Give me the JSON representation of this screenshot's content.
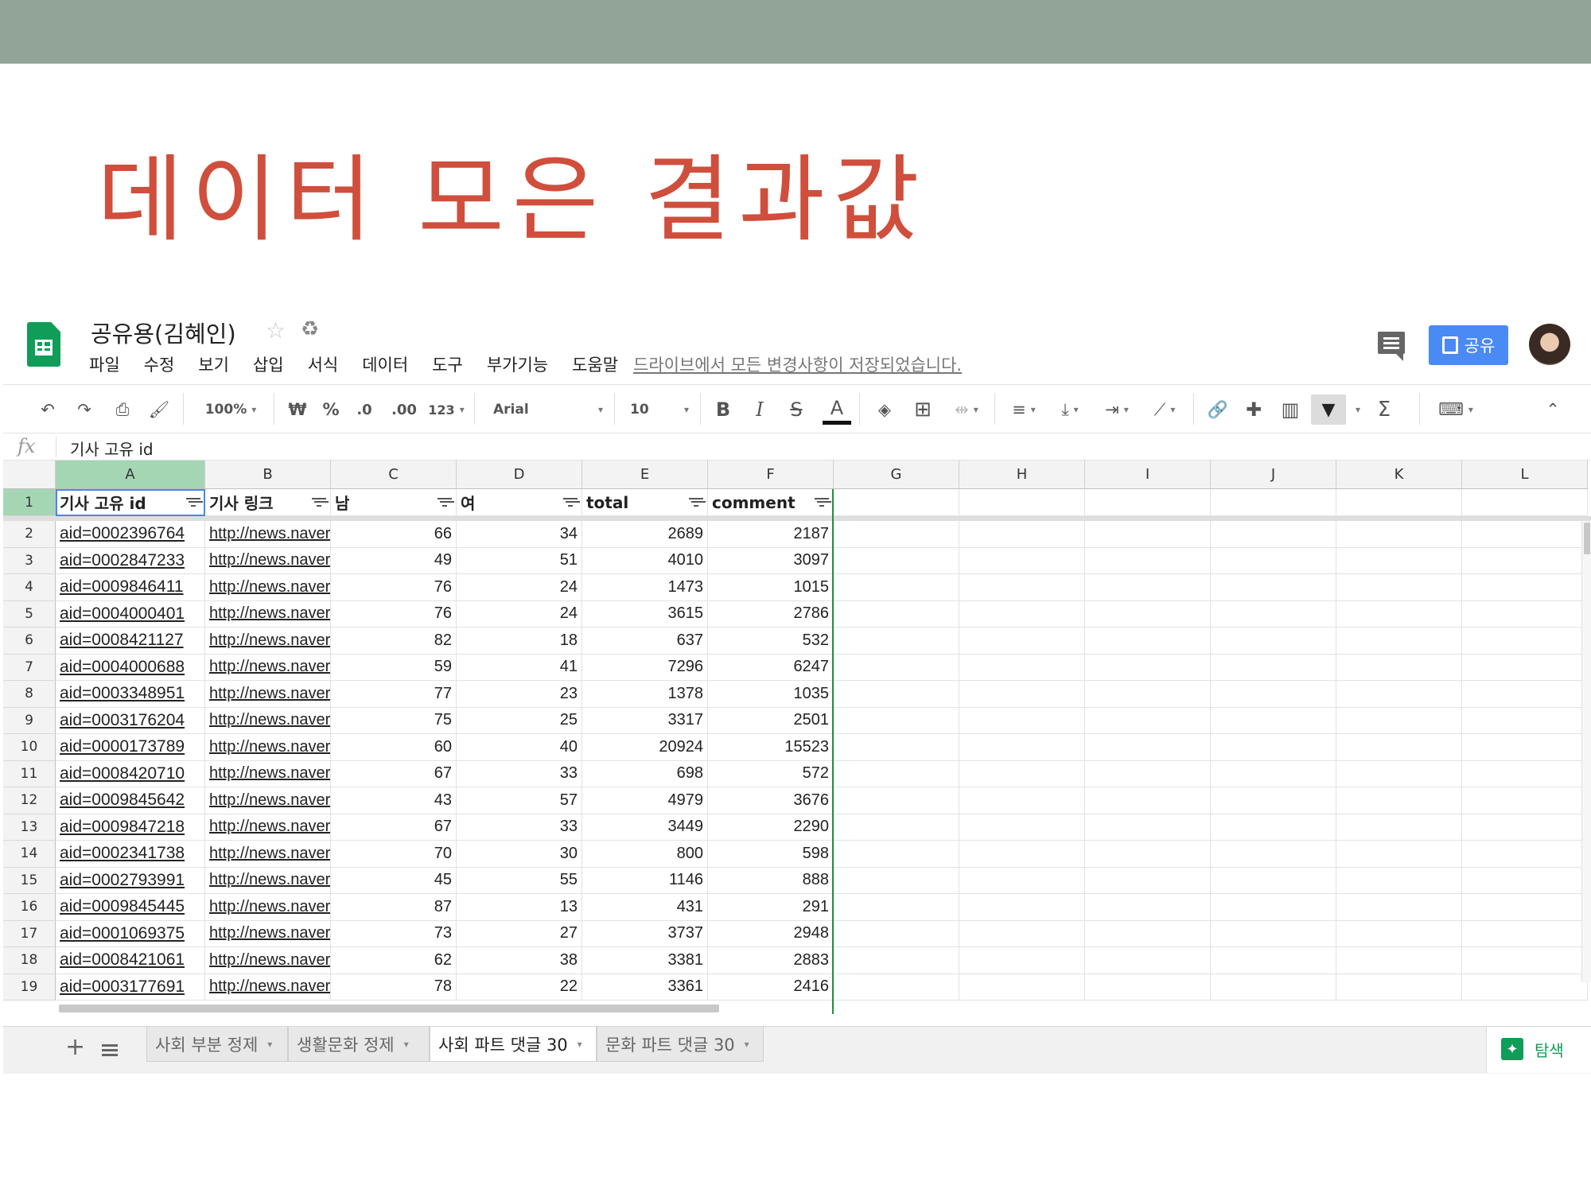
{
  "slide": {
    "title": "데이터 모은 결과값"
  },
  "doc": {
    "title": "공유용(김혜인)",
    "menu": [
      "파일",
      "수정",
      "보기",
      "삽입",
      "서식",
      "데이터",
      "도구",
      "부가기능",
      "도움말"
    ],
    "save_status": "드라이브에서 모든 변경사항이 저장되었습니다.",
    "share_label": "공유",
    "share_color": "#4a8af4"
  },
  "toolbar": {
    "zoom": "100%",
    "currency": "₩",
    "percent": "%",
    "decrease_decimals": ".0",
    "increase_decimals": ".00",
    "more_formats": "123",
    "font": "Arial",
    "font_size": "10",
    "bold": "B",
    "italic": "I",
    "strikethrough": "S",
    "text_color": "A"
  },
  "formula_bar": {
    "content": "기사 고유 id"
  },
  "grid": {
    "column_letters": [
      "A",
      "B",
      "C",
      "D",
      "E",
      "F",
      "G",
      "H",
      "I",
      "J",
      "K",
      "L"
    ],
    "headers": [
      "기사 고유 id",
      "기사 링크",
      "남",
      "여",
      "total",
      "comment"
    ],
    "rows": [
      {
        "num": "2",
        "aid": "aid=0002396764",
        "link": "http://news.naver.c",
        "m": "66",
        "f": "34",
        "total": "2689",
        "comment": "2187"
      },
      {
        "num": "3",
        "aid": "aid=0002847233",
        "link": "http://news.naver.c",
        "m": "49",
        "f": "51",
        "total": "4010",
        "comment": "3097"
      },
      {
        "num": "4",
        "aid": "aid=0009846411",
        "link": "http://news.naver.c",
        "m": "76",
        "f": "24",
        "total": "1473",
        "comment": "1015"
      },
      {
        "num": "5",
        "aid": "aid=0004000401",
        "link": "http://news.naver.c",
        "m": "76",
        "f": "24",
        "total": "3615",
        "comment": "2786"
      },
      {
        "num": "6",
        "aid": "aid=0008421127",
        "link": "http://news.naver.c",
        "m": "82",
        "f": "18",
        "total": "637",
        "comment": "532"
      },
      {
        "num": "7",
        "aid": "aid=0004000688",
        "link": "http://news.naver.c",
        "m": "59",
        "f": "41",
        "total": "7296",
        "comment": "6247"
      },
      {
        "num": "8",
        "aid": "aid=0003348951",
        "link": "http://news.naver.c",
        "m": "77",
        "f": "23",
        "total": "1378",
        "comment": "1035"
      },
      {
        "num": "9",
        "aid": "aid=0003176204",
        "link": "http://news.naver.c",
        "m": "75",
        "f": "25",
        "total": "3317",
        "comment": "2501"
      },
      {
        "num": "10",
        "aid": "aid=0000173789",
        "link": "http://news.naver.c",
        "m": "60",
        "f": "40",
        "total": "20924",
        "comment": "15523"
      },
      {
        "num": "11",
        "aid": "aid=0008420710",
        "link": "http://news.naver.c",
        "m": "67",
        "f": "33",
        "total": "698",
        "comment": "572"
      },
      {
        "num": "12",
        "aid": "aid=0009845642",
        "link": "http://news.naver.c",
        "m": "43",
        "f": "57",
        "total": "4979",
        "comment": "3676"
      },
      {
        "num": "13",
        "aid": "aid=0009847218",
        "link": "http://news.naver.c",
        "m": "67",
        "f": "33",
        "total": "3449",
        "comment": "2290"
      },
      {
        "num": "14",
        "aid": "aid=0002341738",
        "link": "http://news.naver.c",
        "m": "70",
        "f": "30",
        "total": "800",
        "comment": "598"
      },
      {
        "num": "15",
        "aid": "aid=0002793991",
        "link": "http://news.naver.c",
        "m": "45",
        "f": "55",
        "total": "1146",
        "comment": "888"
      },
      {
        "num": "16",
        "aid": "aid=0009845445",
        "link": "http://news.naver.c",
        "m": "87",
        "f": "13",
        "total": "431",
        "comment": "291"
      },
      {
        "num": "17",
        "aid": "aid=0001069375",
        "link": "http://news.naver.c",
        "m": "73",
        "f": "27",
        "total": "3737",
        "comment": "2948"
      },
      {
        "num": "18",
        "aid": "aid=0008421061",
        "link": "http://news.naver.c",
        "m": "62",
        "f": "38",
        "total": "3381",
        "comment": "2883"
      },
      {
        "num": "19",
        "aid": "aid=0003177691",
        "link": "http://news.naver.c",
        "m": "78",
        "f": "22",
        "total": "3361",
        "comment": "2416"
      }
    ]
  },
  "sheets": {
    "tabs": [
      "사회 부분 정제",
      "생활문화 정제",
      "사회 파트 댓글 30",
      "문화 파트 댓글 30"
    ],
    "active_index": 2,
    "explore_label": "탐색"
  }
}
